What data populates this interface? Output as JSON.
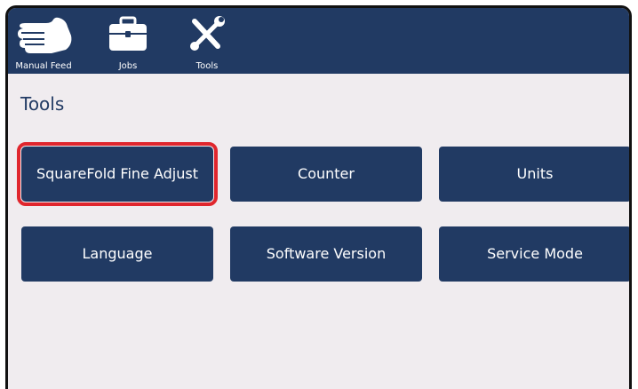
{
  "toolbar": {
    "manual_feed_label": "Manual Feed",
    "jobs_label": "Jobs",
    "tools_label": "Tools"
  },
  "page": {
    "title": "Tools"
  },
  "tiles": [
    {
      "label": "SquareFold Fine Adjust",
      "highlighted": true
    },
    {
      "label": "Counter"
    },
    {
      "label": "Units"
    },
    {
      "label": "Language"
    },
    {
      "label": "Software Version"
    },
    {
      "label": "Service Mode"
    }
  ],
  "colors": {
    "toolbar_bg": "#213a63",
    "tile_bg": "#213a63",
    "content_bg": "#f0ecef",
    "highlight": "#e0262d"
  },
  "icons": [
    "hand-icon",
    "briefcase-icon",
    "tools-icon"
  ]
}
